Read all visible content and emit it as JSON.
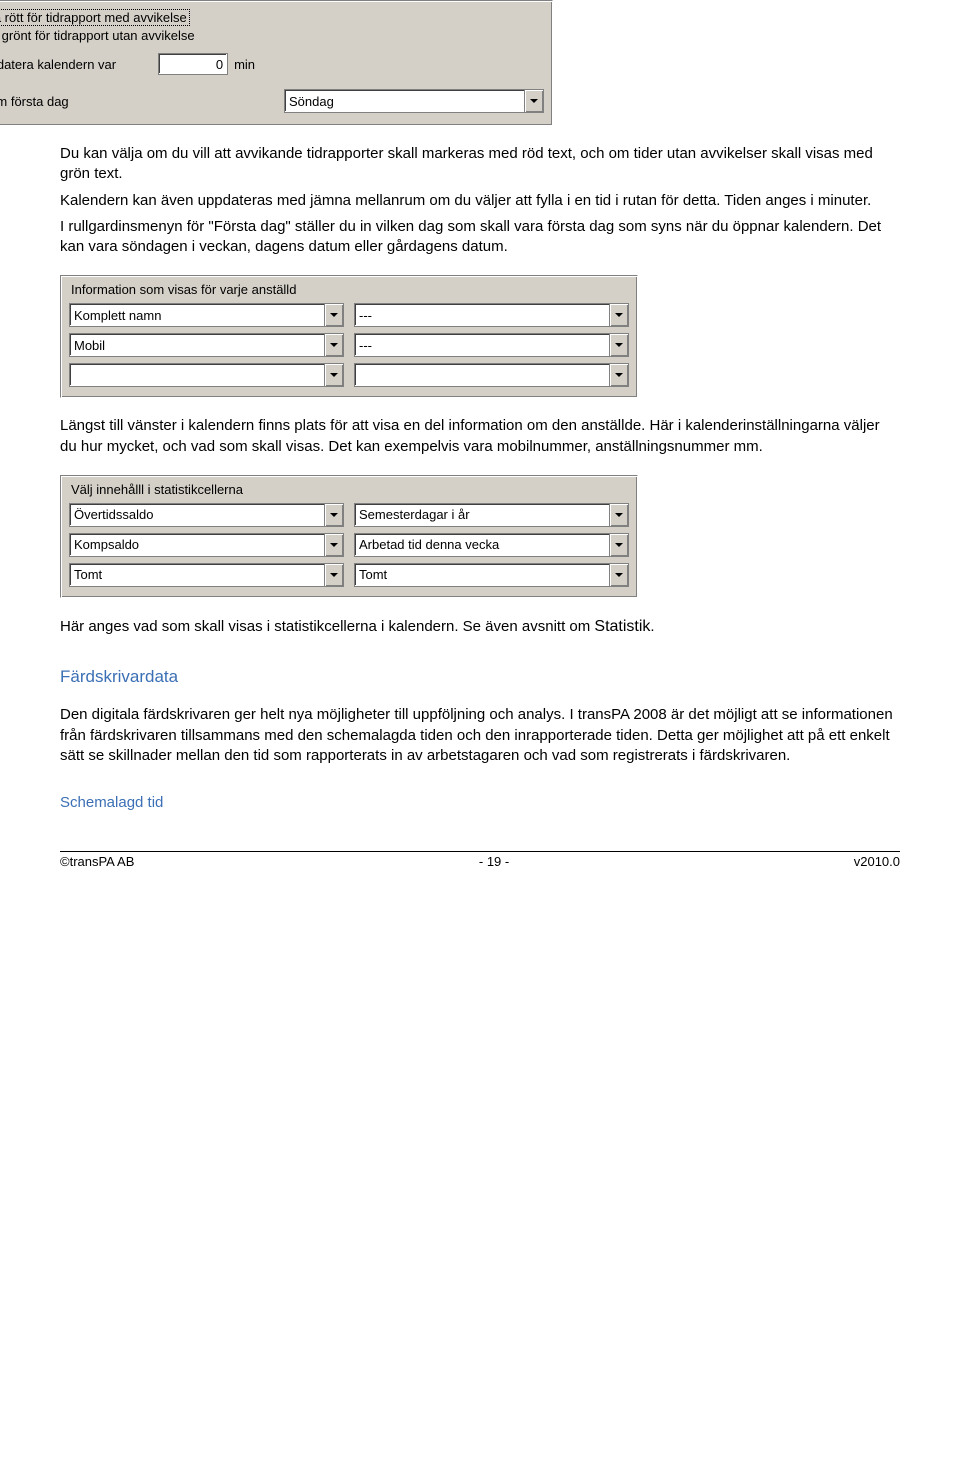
{
  "panel1": {
    "cb1_label": "Visa rött för tidrapport med avvikelse",
    "cb1_checked": true,
    "cb2_label": "Visa grönt för tidrapport utan avvikelse",
    "cb2_checked": true,
    "cb3_label": "Uppdatera kalendern var",
    "cb3_checked": false,
    "interval_value": "0",
    "interval_unit": "min",
    "first_day_label": "Visa som första dag",
    "first_day_value": "Söndag"
  },
  "para1": "Du kan välja om du vill att avvikande tidrapporter skall markeras med röd text, och om tider utan avvikelser skall visas med grön text.",
  "para2": "Kalendern kan även uppdateras med jämna mellanrum om du väljer att fylla i en tid i rutan för detta. Tiden anges i minuter.",
  "para3": "I rullgardinsmenyn för \"Första dag\" ställer du in vilken dag som skall vara första dag som syns när du öppnar kalendern. Det kan vara söndagen i veckan, dagens datum eller gårdagens datum.",
  "panel2": {
    "title": "Information som visas för varje anställd",
    "left": [
      "Komplett namn",
      "Mobil",
      ""
    ],
    "right": [
      "---",
      "---",
      ""
    ]
  },
  "para4": "Längst till vänster i kalendern finns plats för att visa en del information om den anställde. Här i kalenderinställningarna väljer du hur mycket, och vad som skall visas. Det kan exempelvis vara mobilnummer, anställningsnummer mm.",
  "panel3": {
    "title": "Välj innehålll i statistikcellerna",
    "left": [
      "Övertidssaldo",
      "Kompsaldo",
      "Tomt"
    ],
    "right": [
      "Semesterdagar i år",
      "Arbetad tid denna vecka",
      "Tomt"
    ]
  },
  "para5_a": "Här anges vad som skall visas i statistikcellerna i kalendern. Se även avsnitt om ",
  "para5_b": "Statistik",
  "para5_c": ".",
  "section_heading": "Färdskrivardata",
  "para6": "Den digitala färdskrivaren ger helt nya möjligheter till uppföljning och analys. I transPA 2008 är det möjligt att se informationen från färdskrivaren tillsammans med den schemalagda tiden och den inrapporterade tiden. Detta ger möjlighet att på ett enkelt sätt se skillnader mellan den tid som rapporterats in av arbetstagaren och vad som registrerats i färdskrivaren.",
  "subheading": "Schemalagd tid",
  "footer": {
    "left": "©transPA AB",
    "center": "- 19 -",
    "right": "v2010.0"
  }
}
